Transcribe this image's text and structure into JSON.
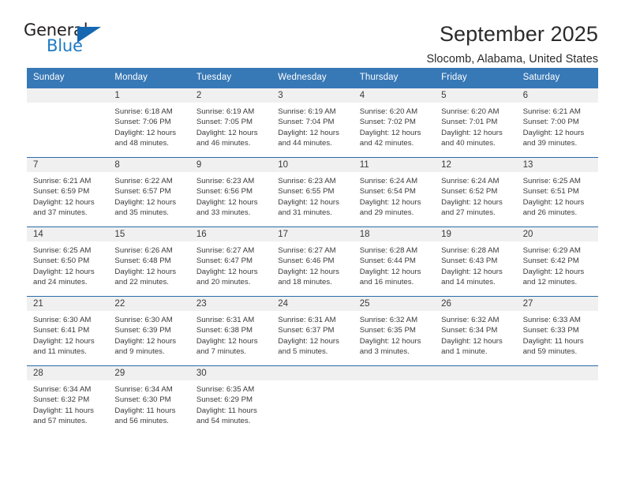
{
  "brand": {
    "name_part1": "General",
    "name_part2": "Blue",
    "triangle_color": "#1567b2",
    "blue_color": "#1f7bc4"
  },
  "header": {
    "title": "September 2025",
    "subtitle": "Slocomb, Alabama, United States"
  },
  "theme": {
    "header_bg": "#3778b6",
    "row_divider": "#2a6ba8",
    "day_band_bg": "#f0f0f0",
    "text": "#3a3a3a"
  },
  "weekdays": [
    "Sunday",
    "Monday",
    "Tuesday",
    "Wednesday",
    "Thursday",
    "Friday",
    "Saturday"
  ],
  "weeks": [
    [
      {
        "day": "",
        "sunrise": "",
        "sunset": "",
        "daylight1": "",
        "daylight2": "",
        "empty": true
      },
      {
        "day": "1",
        "sunrise": "Sunrise: 6:18 AM",
        "sunset": "Sunset: 7:06 PM",
        "daylight1": "Daylight: 12 hours",
        "daylight2": "and 48 minutes."
      },
      {
        "day": "2",
        "sunrise": "Sunrise: 6:19 AM",
        "sunset": "Sunset: 7:05 PM",
        "daylight1": "Daylight: 12 hours",
        "daylight2": "and 46 minutes."
      },
      {
        "day": "3",
        "sunrise": "Sunrise: 6:19 AM",
        "sunset": "Sunset: 7:04 PM",
        "daylight1": "Daylight: 12 hours",
        "daylight2": "and 44 minutes."
      },
      {
        "day": "4",
        "sunrise": "Sunrise: 6:20 AM",
        "sunset": "Sunset: 7:02 PM",
        "daylight1": "Daylight: 12 hours",
        "daylight2": "and 42 minutes."
      },
      {
        "day": "5",
        "sunrise": "Sunrise: 6:20 AM",
        "sunset": "Sunset: 7:01 PM",
        "daylight1": "Daylight: 12 hours",
        "daylight2": "and 40 minutes."
      },
      {
        "day": "6",
        "sunrise": "Sunrise: 6:21 AM",
        "sunset": "Sunset: 7:00 PM",
        "daylight1": "Daylight: 12 hours",
        "daylight2": "and 39 minutes."
      }
    ],
    [
      {
        "day": "7",
        "sunrise": "Sunrise: 6:21 AM",
        "sunset": "Sunset: 6:59 PM",
        "daylight1": "Daylight: 12 hours",
        "daylight2": "and 37 minutes."
      },
      {
        "day": "8",
        "sunrise": "Sunrise: 6:22 AM",
        "sunset": "Sunset: 6:57 PM",
        "daylight1": "Daylight: 12 hours",
        "daylight2": "and 35 minutes."
      },
      {
        "day": "9",
        "sunrise": "Sunrise: 6:23 AM",
        "sunset": "Sunset: 6:56 PM",
        "daylight1": "Daylight: 12 hours",
        "daylight2": "and 33 minutes."
      },
      {
        "day": "10",
        "sunrise": "Sunrise: 6:23 AM",
        "sunset": "Sunset: 6:55 PM",
        "daylight1": "Daylight: 12 hours",
        "daylight2": "and 31 minutes."
      },
      {
        "day": "11",
        "sunrise": "Sunrise: 6:24 AM",
        "sunset": "Sunset: 6:54 PM",
        "daylight1": "Daylight: 12 hours",
        "daylight2": "and 29 minutes."
      },
      {
        "day": "12",
        "sunrise": "Sunrise: 6:24 AM",
        "sunset": "Sunset: 6:52 PM",
        "daylight1": "Daylight: 12 hours",
        "daylight2": "and 27 minutes."
      },
      {
        "day": "13",
        "sunrise": "Sunrise: 6:25 AM",
        "sunset": "Sunset: 6:51 PM",
        "daylight1": "Daylight: 12 hours",
        "daylight2": "and 26 minutes."
      }
    ],
    [
      {
        "day": "14",
        "sunrise": "Sunrise: 6:25 AM",
        "sunset": "Sunset: 6:50 PM",
        "daylight1": "Daylight: 12 hours",
        "daylight2": "and 24 minutes."
      },
      {
        "day": "15",
        "sunrise": "Sunrise: 6:26 AM",
        "sunset": "Sunset: 6:48 PM",
        "daylight1": "Daylight: 12 hours",
        "daylight2": "and 22 minutes."
      },
      {
        "day": "16",
        "sunrise": "Sunrise: 6:27 AM",
        "sunset": "Sunset: 6:47 PM",
        "daylight1": "Daylight: 12 hours",
        "daylight2": "and 20 minutes."
      },
      {
        "day": "17",
        "sunrise": "Sunrise: 6:27 AM",
        "sunset": "Sunset: 6:46 PM",
        "daylight1": "Daylight: 12 hours",
        "daylight2": "and 18 minutes."
      },
      {
        "day": "18",
        "sunrise": "Sunrise: 6:28 AM",
        "sunset": "Sunset: 6:44 PM",
        "daylight1": "Daylight: 12 hours",
        "daylight2": "and 16 minutes."
      },
      {
        "day": "19",
        "sunrise": "Sunrise: 6:28 AM",
        "sunset": "Sunset: 6:43 PM",
        "daylight1": "Daylight: 12 hours",
        "daylight2": "and 14 minutes."
      },
      {
        "day": "20",
        "sunrise": "Sunrise: 6:29 AM",
        "sunset": "Sunset: 6:42 PM",
        "daylight1": "Daylight: 12 hours",
        "daylight2": "and 12 minutes."
      }
    ],
    [
      {
        "day": "21",
        "sunrise": "Sunrise: 6:30 AM",
        "sunset": "Sunset: 6:41 PM",
        "daylight1": "Daylight: 12 hours",
        "daylight2": "and 11 minutes."
      },
      {
        "day": "22",
        "sunrise": "Sunrise: 6:30 AM",
        "sunset": "Sunset: 6:39 PM",
        "daylight1": "Daylight: 12 hours",
        "daylight2": "and 9 minutes."
      },
      {
        "day": "23",
        "sunrise": "Sunrise: 6:31 AM",
        "sunset": "Sunset: 6:38 PM",
        "daylight1": "Daylight: 12 hours",
        "daylight2": "and 7 minutes."
      },
      {
        "day": "24",
        "sunrise": "Sunrise: 6:31 AM",
        "sunset": "Sunset: 6:37 PM",
        "daylight1": "Daylight: 12 hours",
        "daylight2": "and 5 minutes."
      },
      {
        "day": "25",
        "sunrise": "Sunrise: 6:32 AM",
        "sunset": "Sunset: 6:35 PM",
        "daylight1": "Daylight: 12 hours",
        "daylight2": "and 3 minutes."
      },
      {
        "day": "26",
        "sunrise": "Sunrise: 6:32 AM",
        "sunset": "Sunset: 6:34 PM",
        "daylight1": "Daylight: 12 hours",
        "daylight2": "and 1 minute."
      },
      {
        "day": "27",
        "sunrise": "Sunrise: 6:33 AM",
        "sunset": "Sunset: 6:33 PM",
        "daylight1": "Daylight: 11 hours",
        "daylight2": "and 59 minutes."
      }
    ],
    [
      {
        "day": "28",
        "sunrise": "Sunrise: 6:34 AM",
        "sunset": "Sunset: 6:32 PM",
        "daylight1": "Daylight: 11 hours",
        "daylight2": "and 57 minutes."
      },
      {
        "day": "29",
        "sunrise": "Sunrise: 6:34 AM",
        "sunset": "Sunset: 6:30 PM",
        "daylight1": "Daylight: 11 hours",
        "daylight2": "and 56 minutes."
      },
      {
        "day": "30",
        "sunrise": "Sunrise: 6:35 AM",
        "sunset": "Sunset: 6:29 PM",
        "daylight1": "Daylight: 11 hours",
        "daylight2": "and 54 minutes."
      },
      {
        "day": "",
        "sunrise": "",
        "sunset": "",
        "daylight1": "",
        "daylight2": "",
        "empty": true
      },
      {
        "day": "",
        "sunrise": "",
        "sunset": "",
        "daylight1": "",
        "daylight2": "",
        "empty": true
      },
      {
        "day": "",
        "sunrise": "",
        "sunset": "",
        "daylight1": "",
        "daylight2": "",
        "empty": true
      },
      {
        "day": "",
        "sunrise": "",
        "sunset": "",
        "daylight1": "",
        "daylight2": "",
        "empty": true
      }
    ]
  ]
}
